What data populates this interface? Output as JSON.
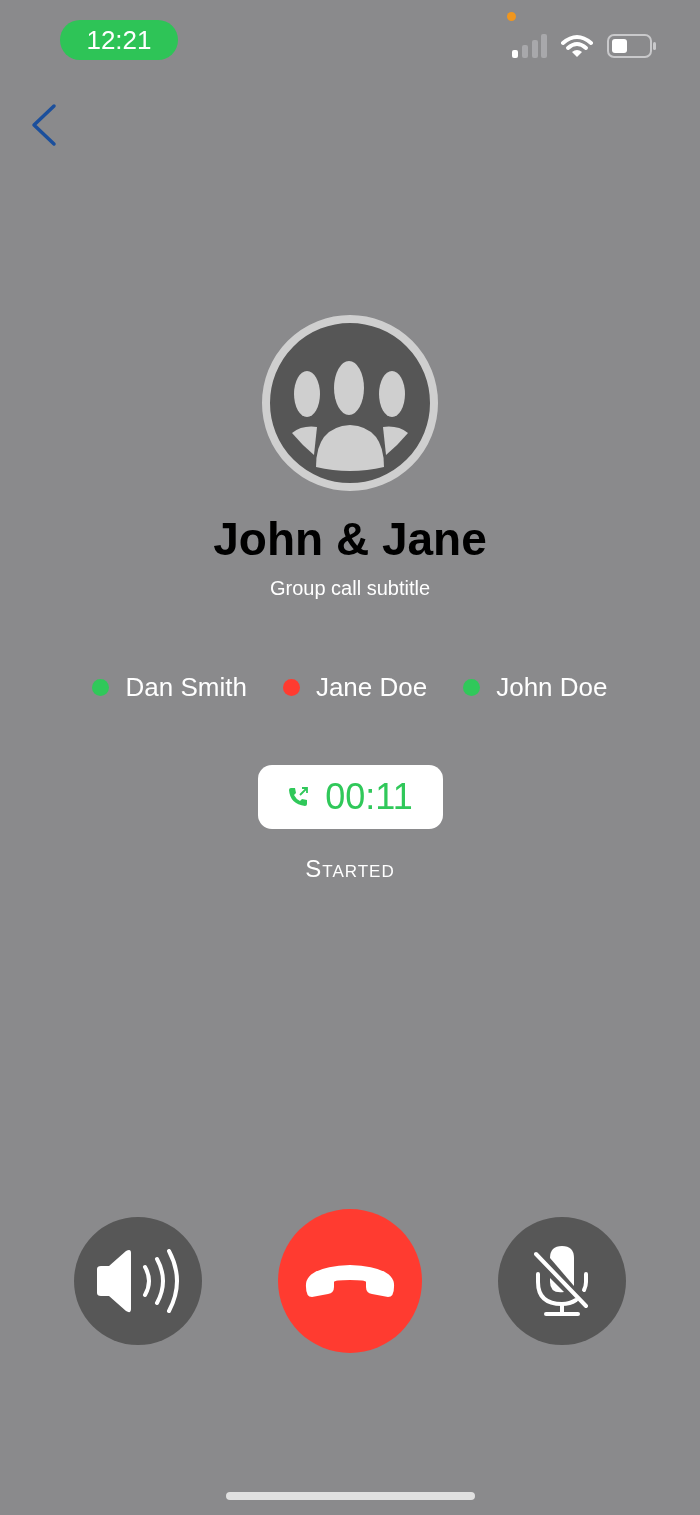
{
  "status_bar": {
    "time": "12:21"
  },
  "call": {
    "title": "John & Jane",
    "subtitle": "Group call subtitle"
  },
  "participants": [
    {
      "name": "Dan Smith",
      "color": "#30c85a"
    },
    {
      "name": "Jane Doe",
      "color": "#ff3b30"
    },
    {
      "name": "John Doe",
      "color": "#30c85a"
    }
  ],
  "timer": {
    "duration": "00:11",
    "status": "Started"
  },
  "controls": [
    {
      "kind": "speaker"
    },
    {
      "kind": "end"
    },
    {
      "kind": "mute"
    }
  ]
}
